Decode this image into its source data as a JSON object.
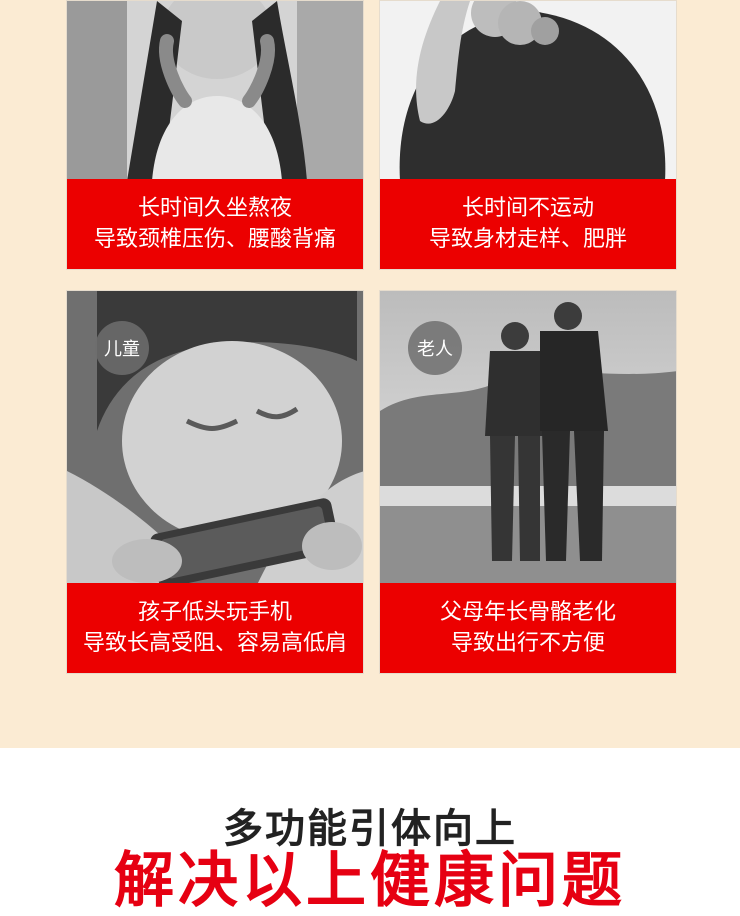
{
  "cards": [
    {
      "line1": "长时间久坐熬夜",
      "line2": "导致颈椎压伤、腰酸背痛",
      "badge": ""
    },
    {
      "line1": "长时间不运动",
      "line2": "导致身材走样、肥胖",
      "badge": ""
    },
    {
      "line1": "孩子低头玩手机",
      "line2": "导致长高受阻、容易高低肩",
      "badge": "儿童"
    },
    {
      "line1": "父母年长骨骼老化",
      "line2": "导致出行不方便",
      "badge": "老人"
    }
  ],
  "headline": {
    "line1": "多功能引体向上",
    "line2": "解决以上健康问题"
  },
  "colors": {
    "cream": "#fbebd3",
    "caption_red": "#ec0000",
    "headline_red": "#e60012",
    "headline_dark": "#222222"
  }
}
